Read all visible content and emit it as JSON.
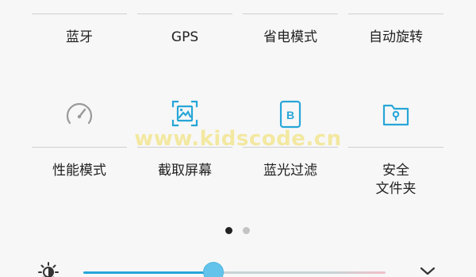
{
  "quick_settings": {
    "row1": [
      {
        "label": "蓝牙"
      },
      {
        "label": "GPS"
      },
      {
        "label": "省电模式"
      },
      {
        "label": "自动旋转"
      }
    ],
    "row2": [
      {
        "label": "性能模式",
        "icon": "speedometer-icon",
        "active": false
      },
      {
        "label": "截取屏幕",
        "icon": "screenshot-icon",
        "active": true
      },
      {
        "label": "蓝光过滤",
        "icon": "blue-light-filter-icon",
        "active": true,
        "icon_letter": "B"
      },
      {
        "label_line1": "安全",
        "label_line2": "文件夹",
        "icon": "secure-folder-icon",
        "active": true
      }
    ]
  },
  "watermark": "www.kidscode.cn",
  "pager": {
    "total": 2,
    "current": 1
  },
  "brightness": {
    "icon": "brightness-auto-icon",
    "level_percent": 31,
    "expand_icon": "chevron-down-icon"
  },
  "colors": {
    "accent": "#27a6d8",
    "inactive_icon": "#9a9a9a",
    "text": "#222222"
  }
}
